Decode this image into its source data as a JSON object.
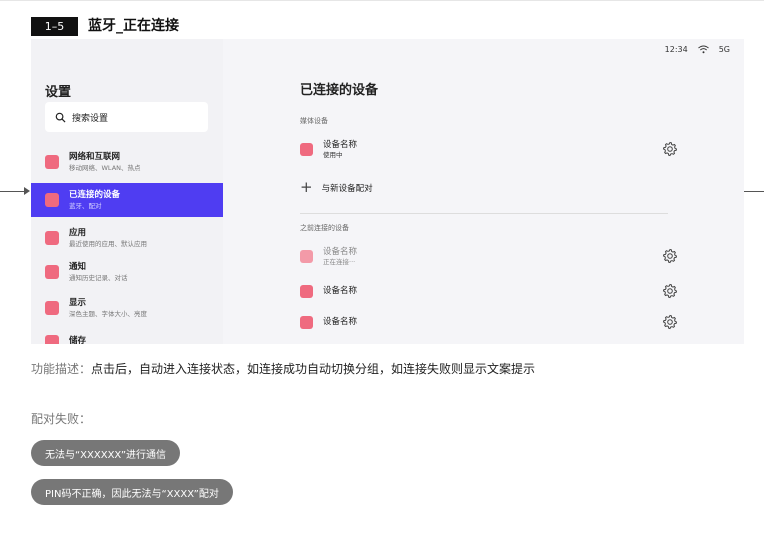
{
  "header": {
    "step": "1–5",
    "title": "蓝牙_正在连接"
  },
  "status_bar": {
    "time": "12:34",
    "network": "5G"
  },
  "sidebar": {
    "title": "设置",
    "search_placeholder": "搜索设置",
    "items": [
      {
        "label": "网络和互联网",
        "sub": "移动网络、WLAN、热点",
        "active": false
      },
      {
        "label": "已连接的设备",
        "sub": "蓝牙、配对",
        "active": true
      },
      {
        "label": "应用",
        "sub": "最近使用的应用、默认应用",
        "active": false
      },
      {
        "label": "通知",
        "sub": "通知历史记录、对话",
        "active": false
      },
      {
        "label": "显示",
        "sub": "深色主题、字体大小、亮度",
        "active": false
      },
      {
        "label": "储存",
        "sub": "",
        "active": false
      }
    ]
  },
  "main": {
    "title": "已连接的设备",
    "media_label": "媒体设备",
    "media_device": {
      "name": "设备名称",
      "status": "使用中"
    },
    "pair_new": "与新设备配对",
    "previous_label": "之前连接的设备",
    "previous_devices": [
      {
        "name": "设备名称",
        "status": "正在连接···"
      },
      {
        "name": "设备名称",
        "status": ""
      },
      {
        "name": "设备名称",
        "status": ""
      }
    ]
  },
  "description": {
    "label": "功能描述：",
    "text": "点击后，自动进入连接状态，如连接成功自动切换分组，如连接失败则显示文案提示"
  },
  "failure": {
    "label": "配对失败：",
    "toasts": [
      "无法与“XXXXXX”进行通信",
      "PIN码不正确，因此无法与“XXXX”配对"
    ]
  },
  "colors": {
    "accent": "#4f3df2",
    "icon_pink": "#ef6a7f",
    "toast_bg": "#777777"
  }
}
